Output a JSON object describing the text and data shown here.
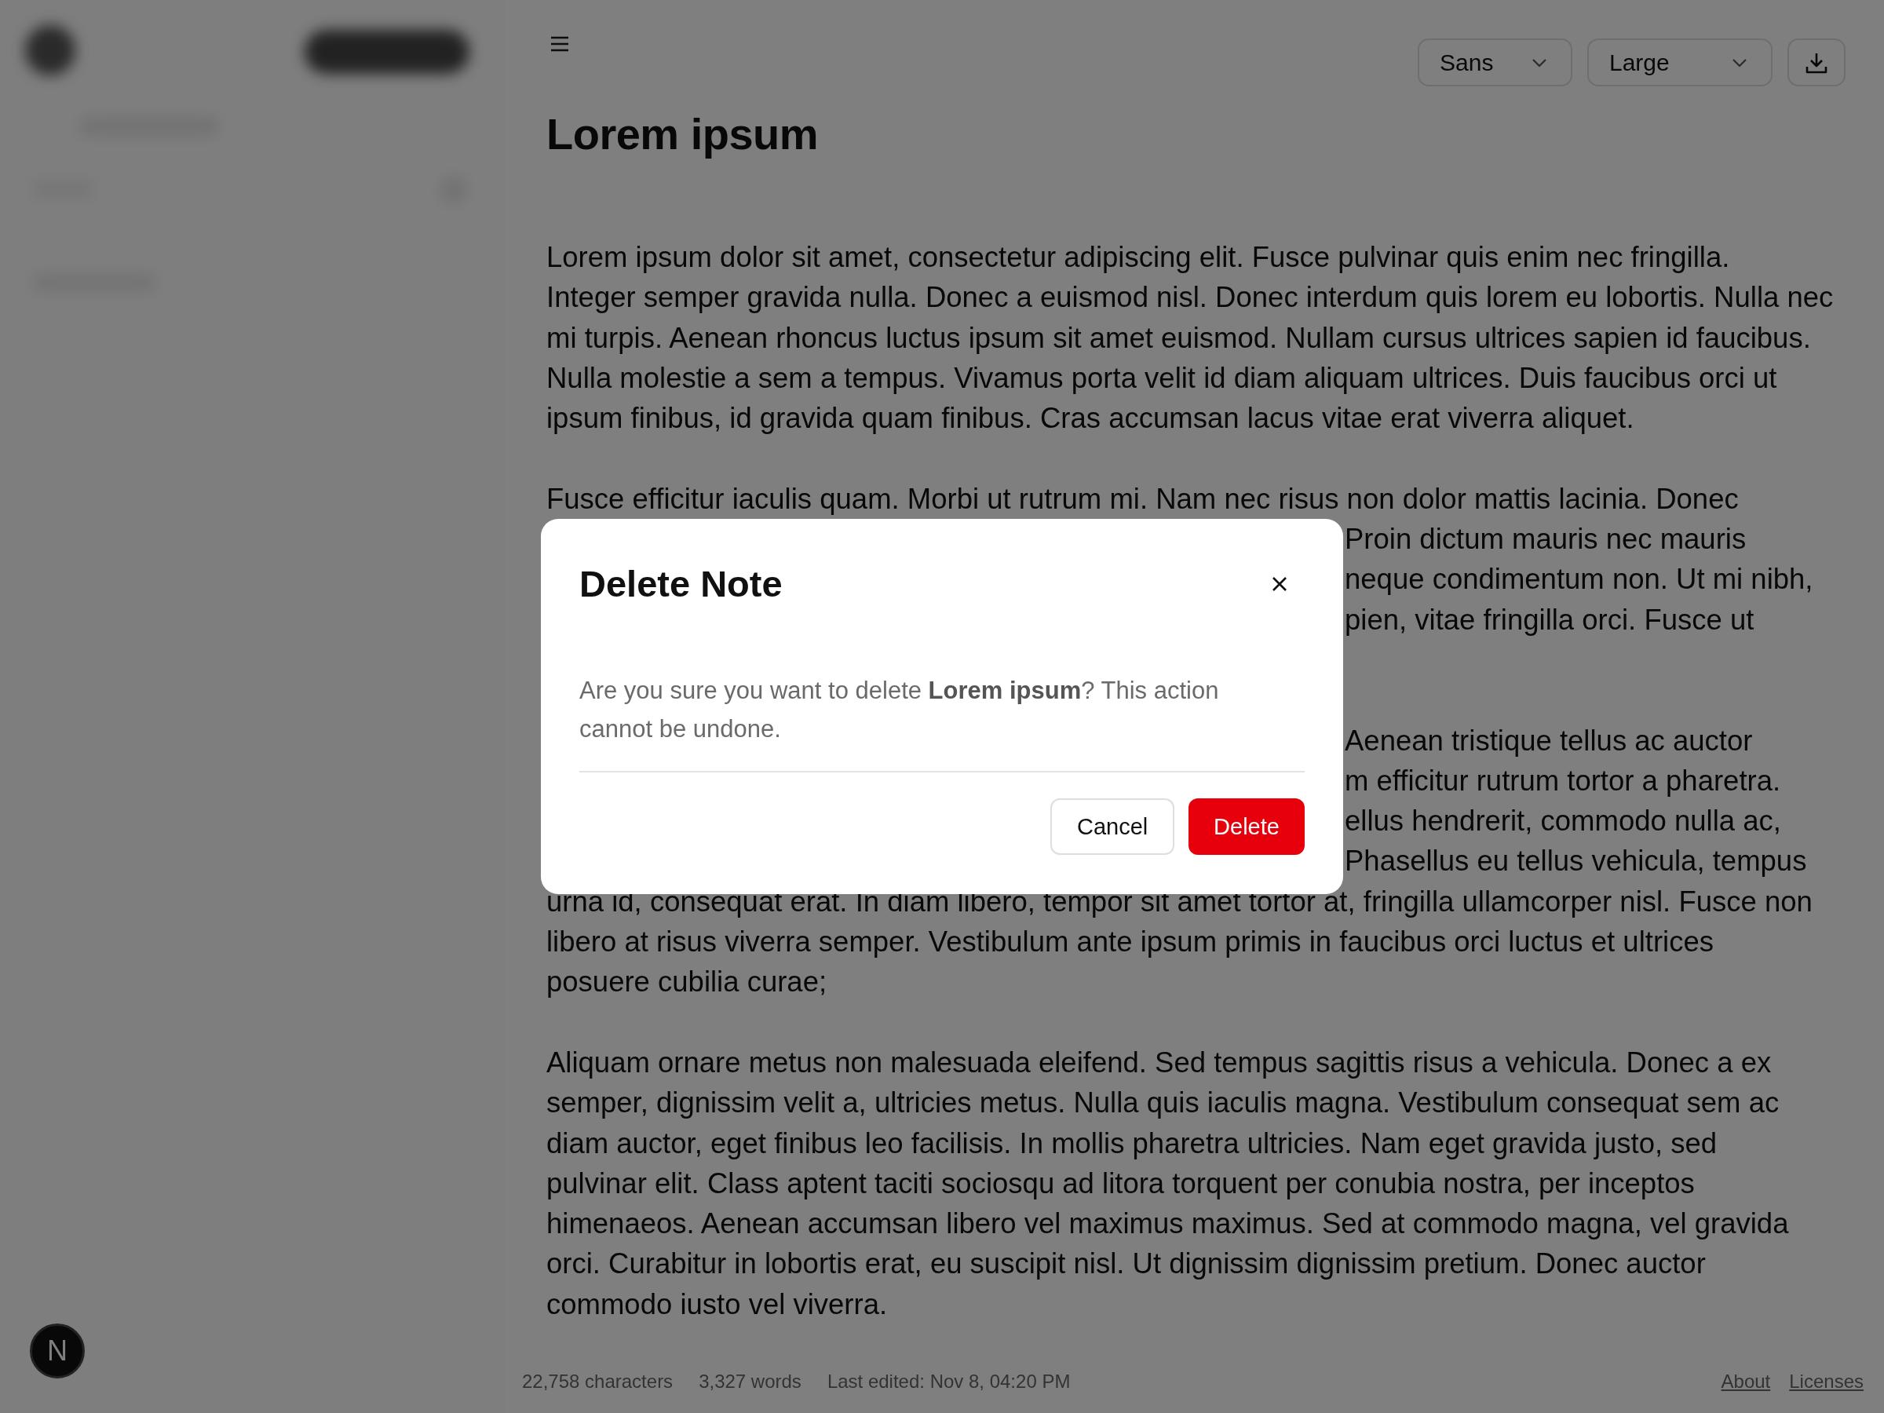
{
  "toolbar": {
    "font": "Sans",
    "size": "Large"
  },
  "document": {
    "title": "Lorem ipsum",
    "paragraphs": [
      {
        "lines": [
          {
            "kind": "full",
            "text": "Lorem ipsum dolor sit amet, consectetur adipiscing elit. Fusce pulvinar quis enim nec fringilla."
          },
          {
            "kind": "full",
            "text": "Integer semper gravida nulla. Donec a euismod nisl. Donec interdum quis lorem eu lobortis. Nulla nec"
          },
          {
            "kind": "full",
            "text": "mi turpis. Aenean rhoncus luctus ipsum sit amet euismod. Nullam cursus ultrices sapien id faucibus."
          },
          {
            "kind": "full",
            "text": "Nulla molestie a sem a tempus. Vivamus porta velit id diam aliquam ultrices. Duis faucibus orci ut"
          },
          {
            "kind": "full",
            "text": "ipsum finibus, id gravida quam finibus. Cras accumsan lacus vitae erat viverra aliquet."
          }
        ]
      },
      {
        "lines": [
          {
            "kind": "full",
            "text": "Fusce efficitur iaculis quam. Morbi ut rutrum mi. Nam nec risus non dolor mattis lacinia. Donec"
          },
          {
            "kind": "fragment",
            "text": "Proin dictum mauris nec mauris"
          },
          {
            "kind": "fragment",
            "text": "neque condimentum non. Ut mi nibh,"
          },
          {
            "kind": "fragment",
            "text": "pien, vitae fringilla orci. Fusce ut"
          }
        ]
      },
      {
        "lines": [
          {
            "kind": "fragment",
            "text": "Aenean tristique tellus ac auctor"
          },
          {
            "kind": "fragment",
            "text": "m efficitur rutrum tortor a pharetra."
          },
          {
            "kind": "fragment",
            "text": "ellus hendrerit, commodo nulla ac,"
          },
          {
            "kind": "fragment",
            "text": "Phasellus eu tellus vehicula, tempus"
          },
          {
            "kind": "full",
            "text": "urna id, consequat erat. In diam libero, tempor sit amet tortor at, fringilla ullamcorper nisl. Fusce non"
          },
          {
            "kind": "full",
            "text": "libero at risus viverra semper. Vestibulum ante ipsum primis in faucibus orci luctus et ultrices"
          },
          {
            "kind": "full",
            "text": "posuere cubilia curae;"
          }
        ]
      },
      {
        "lines": [
          {
            "kind": "full",
            "text": "Aliquam ornare metus non malesuada eleifend. Sed tempus sagittis risus a vehicula. Donec a ex"
          },
          {
            "kind": "full",
            "text": "semper, dignissim velit a, ultricies metus. Nulla quis iaculis magna. Vestibulum consequat sem ac"
          },
          {
            "kind": "full",
            "text": "diam auctor, eget finibus leo facilisis. In mollis pharetra ultricies. Nam eget gravida justo, sed"
          },
          {
            "kind": "full",
            "text": "pulvinar elit. Class aptent taciti sociosqu ad litora torquent per conubia nostra, per inceptos"
          },
          {
            "kind": "full",
            "text": "himenaeos. Aenean accumsan libero vel maximus maximus. Sed at commodo magna, vel gravida"
          },
          {
            "kind": "full",
            "text": "orci. Curabitur in lobortis erat, eu suscipit nisl. Ut dignissim dignissim pretium. Donec auctor"
          },
          {
            "kind": "full",
            "text": "commodo iusto vel viverra."
          }
        ]
      }
    ]
  },
  "status_bar": {
    "stats": [
      "22,758 characters",
      "3,327 words",
      "Last edited: Nov 8, 04:20 PM"
    ],
    "links": [
      "About",
      "Licenses"
    ]
  },
  "badge": {
    "label": "N"
  },
  "dialog": {
    "title": "Delete Note",
    "message": "Are you sure you want to delete **Lorem ipsum**? This action cannot be undone.",
    "buttons": [
      {
        "label": "Cancel",
        "kind": "secondary"
      },
      {
        "label": "Delete",
        "kind": "danger"
      }
    ]
  }
}
